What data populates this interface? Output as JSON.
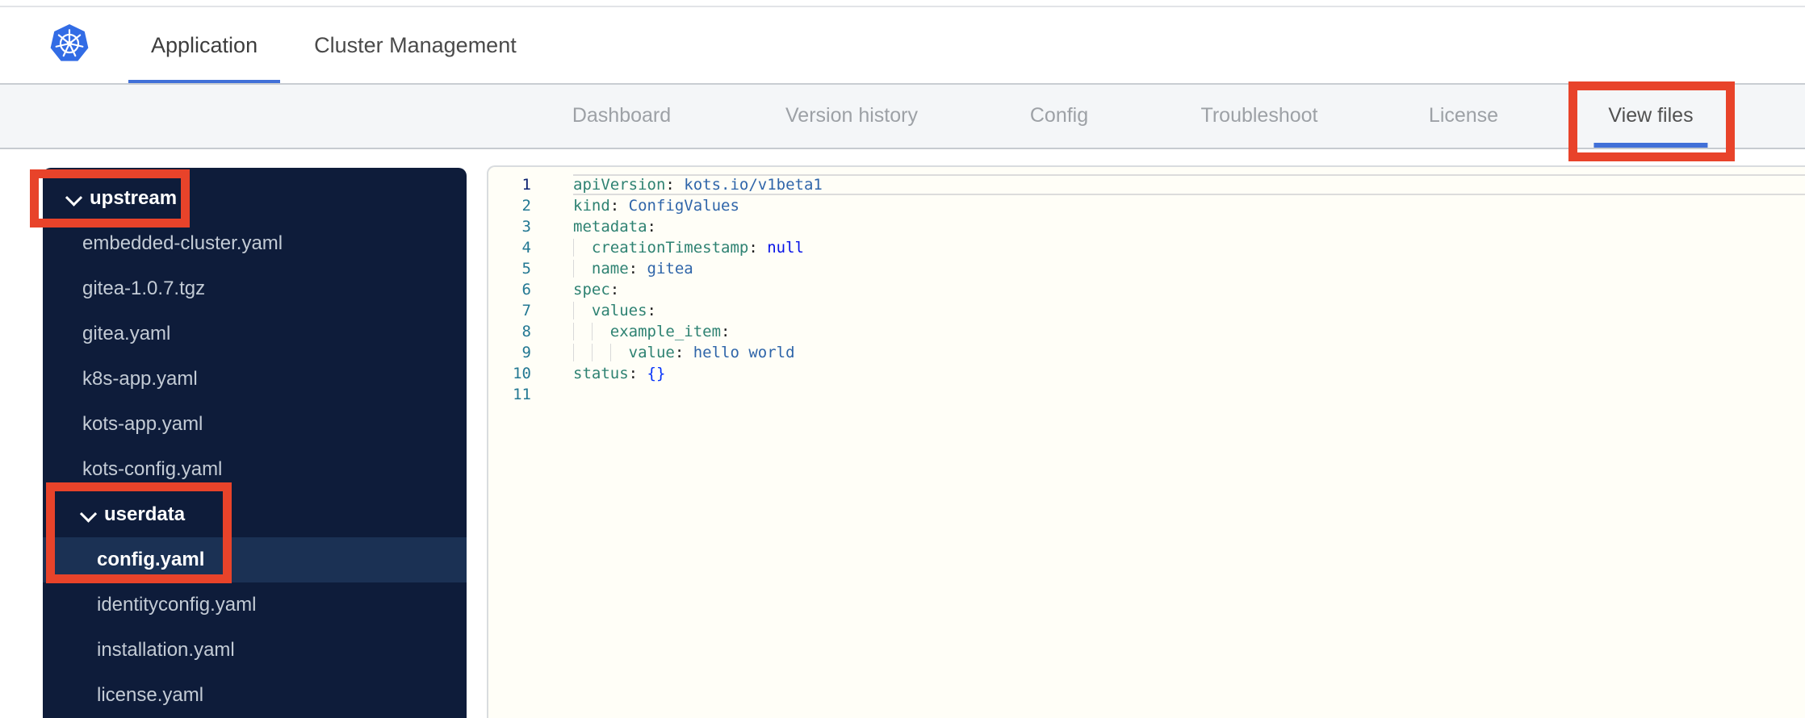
{
  "header": {
    "logo": "kubernetes-logo",
    "accent_color": "#4170d8",
    "tabs": [
      {
        "label": "Application",
        "active": true
      },
      {
        "label": "Cluster Management",
        "active": false
      }
    ]
  },
  "subnav": {
    "tabs": [
      {
        "label": "Dashboard",
        "active": false
      },
      {
        "label": "Version history",
        "active": false
      },
      {
        "label": "Config",
        "active": false
      },
      {
        "label": "Troubleshoot",
        "active": false
      },
      {
        "label": "License",
        "active": false
      },
      {
        "label": "View files",
        "active": true
      }
    ]
  },
  "file_tree": {
    "colors": {
      "bg": "#0e1c3a",
      "selected_bg": "#1b3154",
      "file_text": "#c3cbd5",
      "folder_text": "#ffffff"
    },
    "items": [
      {
        "label": "upstream",
        "type": "folder",
        "level": 0,
        "expanded": true,
        "selected": false
      },
      {
        "label": "embedded-cluster.yaml",
        "type": "file",
        "level": 1,
        "selected": false
      },
      {
        "label": "gitea-1.0.7.tgz",
        "type": "file",
        "level": 1,
        "selected": false
      },
      {
        "label": "gitea.yaml",
        "type": "file",
        "level": 1,
        "selected": false
      },
      {
        "label": "k8s-app.yaml",
        "type": "file",
        "level": 1,
        "selected": false
      },
      {
        "label": "kots-app.yaml",
        "type": "file",
        "level": 1,
        "selected": false
      },
      {
        "label": "kots-config.yaml",
        "type": "file",
        "level": 1,
        "selected": false
      },
      {
        "label": "userdata",
        "type": "folder",
        "level": 1,
        "expanded": true,
        "selected": false
      },
      {
        "label": "config.yaml",
        "type": "file",
        "level": 2,
        "selected": true
      },
      {
        "label": "identityconfig.yaml",
        "type": "file",
        "level": 2,
        "selected": false
      },
      {
        "label": "installation.yaml",
        "type": "file",
        "level": 2,
        "selected": false
      },
      {
        "label": "license.yaml",
        "type": "file",
        "level": 2,
        "selected": false
      }
    ]
  },
  "editor": {
    "language": "yaml",
    "colors": {
      "key": "#2e8272",
      "string": "#2f65a9",
      "keyword": "#0713e8",
      "bracket": "#0431fa",
      "line_number": "#237893",
      "line_number_active": "#0b216f"
    },
    "lines": [
      {
        "num": 1,
        "indent": 0,
        "key": "apiVersion",
        "value": "kots.io/v1beta1",
        "vtype": "str",
        "current": true
      },
      {
        "num": 2,
        "indent": 0,
        "key": "kind",
        "value": "ConfigValues",
        "vtype": "str"
      },
      {
        "num": 3,
        "indent": 0,
        "key": "metadata",
        "value": "",
        "vtype": ""
      },
      {
        "num": 4,
        "indent": 2,
        "key": "creationTimestamp",
        "value": "null",
        "vtype": "kw"
      },
      {
        "num": 5,
        "indent": 2,
        "key": "name",
        "value": "gitea",
        "vtype": "str"
      },
      {
        "num": 6,
        "indent": 0,
        "key": "spec",
        "value": "",
        "vtype": ""
      },
      {
        "num": 7,
        "indent": 2,
        "key": "values",
        "value": "",
        "vtype": ""
      },
      {
        "num": 8,
        "indent": 4,
        "key": "example_item",
        "value": "",
        "vtype": ""
      },
      {
        "num": 9,
        "indent": 6,
        "key": "value",
        "value": "hello world",
        "vtype": "str"
      },
      {
        "num": 10,
        "indent": 0,
        "key": "status",
        "value": "{}",
        "vtype": "bracket"
      },
      {
        "num": 11,
        "indent": 0,
        "key": "",
        "value": "",
        "vtype": ""
      }
    ]
  },
  "annotations": {
    "color": "#e8432a",
    "highlighted": [
      "upstream folder",
      "userdata / config.yaml",
      "View files tab"
    ]
  }
}
